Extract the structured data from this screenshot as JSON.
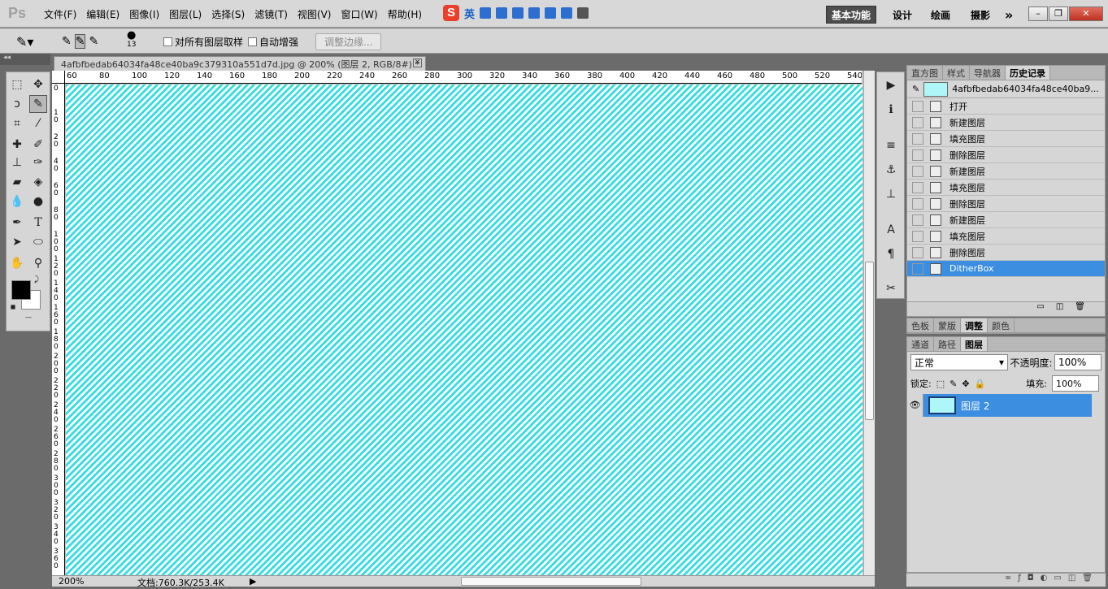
{
  "app": {
    "logo": "Ps"
  },
  "menu": [
    "文件(F)",
    "编辑(E)",
    "图像(I)",
    "图层(L)",
    "选择(S)",
    "滤镜(T)",
    "视图(V)",
    "窗口(W)",
    "帮助(H)"
  ],
  "ime": {
    "logo": "S",
    "lang": "英"
  },
  "workspaces": {
    "active": "基本功能",
    "items": [
      "设计",
      "绘画",
      "摄影"
    ],
    "more": "»"
  },
  "window_buttons": {
    "minimize": "–",
    "restore": "❐",
    "close": "✕"
  },
  "options": {
    "brush_size": "13",
    "sample_all": "对所有图层取样",
    "auto_enhance": "自动增强",
    "refine_edge": "调整边缘..."
  },
  "document": {
    "tab_title": "4afbfbedab64034fa48ce40ba9c379310a551d7d.jpg @ 200% (图层 2, RGB/8#) *",
    "close": "✕",
    "ruler_top": [
      "60",
      "80",
      "100",
      "120",
      "140",
      "160",
      "180",
      "200",
      "220",
      "240",
      "260",
      "280",
      "300",
      "320",
      "340",
      "360",
      "380",
      "400",
      "420",
      "440",
      "460",
      "480",
      "500",
      "520",
      "540"
    ],
    "ruler_left": [
      "0",
      "10",
      "20",
      "40",
      "60",
      "80",
      "100",
      "120",
      "140",
      "160",
      "180",
      "200",
      "220",
      "240",
      "260",
      "280",
      "300",
      "320",
      "340",
      "360"
    ]
  },
  "status": {
    "zoom": "200%",
    "doc_info": "文档:760.3K/253.4K"
  },
  "panel_top": {
    "tabs": [
      "直方图",
      "样式",
      "导航器",
      "历史记录"
    ],
    "active": "历史记录",
    "source": "4afbfbedab64034fa48ce40ba9...",
    "history": [
      "打开",
      "新建图层",
      "填充图层",
      "删除图层",
      "新建图层",
      "填充图层",
      "删除图层",
      "新建图层",
      "填充图层",
      "删除图层",
      "DitherBox"
    ],
    "selected": "DitherBox"
  },
  "panel_adj": {
    "tabs": [
      "色板",
      "蒙版",
      "调整",
      "颜色"
    ],
    "active": "调整"
  },
  "panel_layers": {
    "tabs": [
      "通道",
      "路径",
      "图层"
    ],
    "active": "图层",
    "blend_mode": "正常",
    "opacity_label": "不透明度:",
    "opacity": "100%",
    "lock_label": "锁定:",
    "fill_label": "填充:",
    "fill": "100%",
    "layers": [
      {
        "name": "图层 2",
        "visible": true
      }
    ]
  },
  "colors": {
    "canvas_stripe": "#33dde0",
    "selection": "#3b8ee0",
    "thumb": "#aff6f8"
  }
}
